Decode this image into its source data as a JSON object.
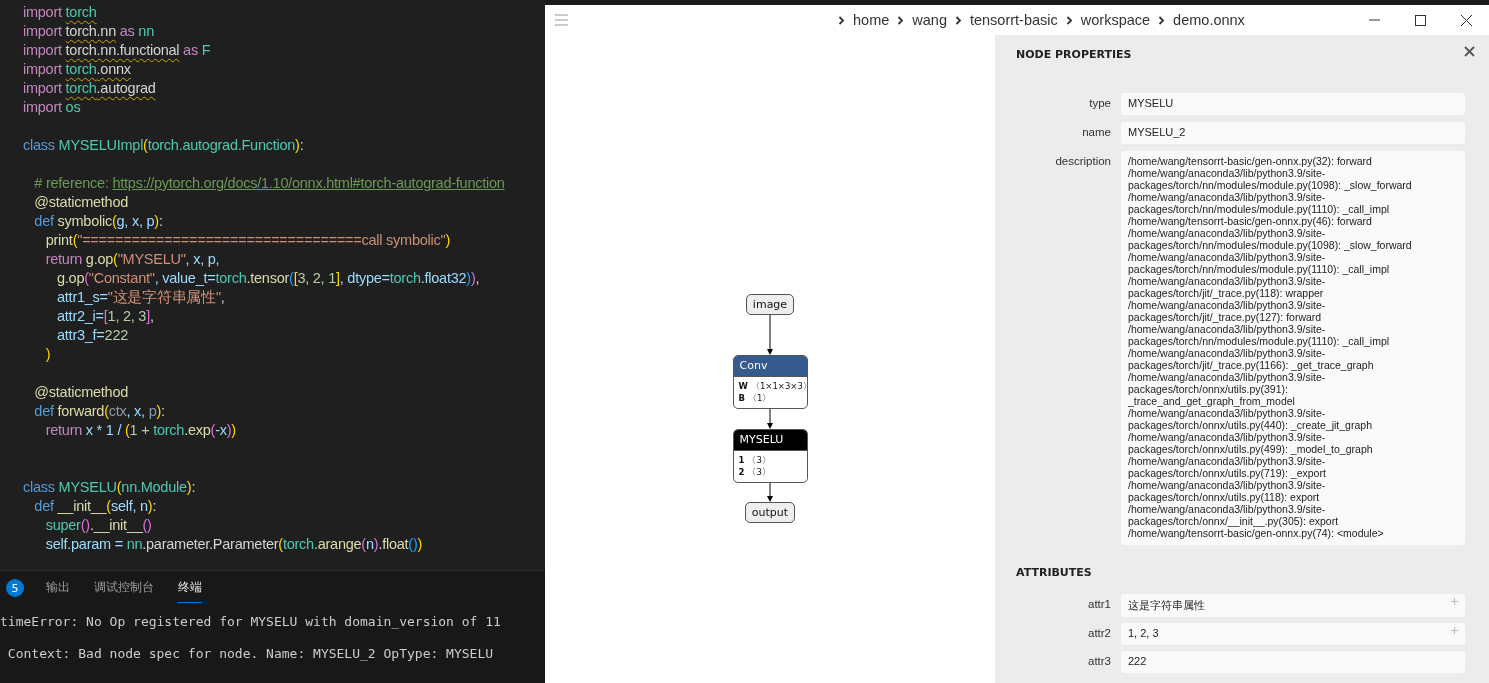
{
  "editor": {
    "lines": [
      {
        "tokens": [
          {
            "text": "import ",
            "kind": "keyword"
          },
          {
            "text": "torch",
            "kind": "module",
            "squiggle": true
          }
        ]
      },
      {
        "tokens": [
          {
            "text": "import ",
            "kind": "keyword"
          },
          {
            "text": "torch.nn",
            "kind": "plain",
            "squiggle": true
          },
          {
            "text": " as ",
            "kind": "keyword"
          },
          {
            "text": "nn",
            "kind": "module"
          }
        ]
      },
      {
        "tokens": [
          {
            "text": "import ",
            "kind": "keyword"
          },
          {
            "text": "torch.nn.functional",
            "kind": "plain",
            "squiggle": true
          },
          {
            "text": " as ",
            "kind": "keyword"
          },
          {
            "text": "F",
            "kind": "module"
          }
        ]
      },
      {
        "tokens": [
          {
            "text": "import ",
            "kind": "keyword"
          },
          {
            "text": "torch",
            "kind": "module",
            "squiggle": true
          },
          {
            "text": ".onnx",
            "kind": "plain",
            "squiggle": true
          }
        ]
      },
      {
        "tokens": [
          {
            "text": "import ",
            "kind": "keyword"
          },
          {
            "text": "torch",
            "kind": "module",
            "squiggle": true
          },
          {
            "text": ".autograd",
            "kind": "plain",
            "squiggle": true
          }
        ]
      },
      {
        "tokens": [
          {
            "text": "import ",
            "kind": "keyword"
          },
          {
            "text": "os",
            "kind": "module"
          }
        ]
      },
      {
        "kind": "after-blank",
        "tokens": [
          {
            "text": "class ",
            "kind": "storage"
          },
          {
            "text": "MYSELUImpl",
            "kind": "module"
          },
          {
            "text": "(",
            "kind": "bracket1"
          },
          {
            "text": "torch.autograd.Function",
            "kind": "module"
          },
          {
            "text": ")",
            "kind": "bracket1"
          },
          {
            "text": ":",
            "kind": "plain"
          }
        ]
      },
      {
        "kind": "after-blank",
        "tokens": [
          {
            "text": "   # reference: ",
            "kind": "comment"
          },
          {
            "text": "https://pytorch.org/docs/1.10/onnx.html#torch-autograd-function",
            "kind": "link"
          }
        ]
      },
      {
        "tokens": [
          {
            "text": "   @staticmethod",
            "kind": "decorator"
          }
        ]
      },
      {
        "tokens": [
          {
            "text": "   def ",
            "kind": "storage"
          },
          {
            "text": "symbolic",
            "kind": "function"
          },
          {
            "text": "(",
            "kind": "bracket1"
          },
          {
            "text": "g, x, p",
            "kind": "variable"
          },
          {
            "text": ")",
            "kind": "bracket1"
          },
          {
            "text": ":",
            "kind": "plain"
          }
        ]
      },
      {
        "tokens": [
          {
            "text": "      print",
            "kind": "function"
          },
          {
            "text": "(",
            "kind": "bracket1"
          },
          {
            "text": "\"==================================call symbolic\"",
            "kind": "string"
          },
          {
            "text": ")",
            "kind": "bracket1"
          }
        ]
      },
      {
        "tokens": [
          {
            "text": "      return ",
            "kind": "keyword"
          },
          {
            "text": "g.op",
            "kind": "function"
          },
          {
            "text": "(",
            "kind": "bracket1"
          },
          {
            "text": "\"MYSELU\"",
            "kind": "string"
          },
          {
            "text": ", x, p,",
            "kind": "variable"
          }
        ]
      },
      {
        "tokens": [
          {
            "text": "         g.op",
            "kind": "function"
          },
          {
            "text": "(",
            "kind": "bracket2"
          },
          {
            "text": "\"Constant\"",
            "kind": "string"
          },
          {
            "text": ", value_t=",
            "kind": "variable"
          },
          {
            "text": "torch",
            "kind": "module"
          },
          {
            "text": ".tensor",
            "kind": "function"
          },
          {
            "text": "(",
            "kind": "bracket3"
          },
          {
            "text": "[",
            "kind": "bracket1"
          },
          {
            "text": "3, 2, 1",
            "kind": "number"
          },
          {
            "text": "]",
            "kind": "bracket1"
          },
          {
            "text": ", dtype=",
            "kind": "variable"
          },
          {
            "text": "torch",
            "kind": "module"
          },
          {
            "text": ".float32",
            "kind": "variable"
          },
          {
            "text": ")",
            "kind": "bracket3"
          },
          {
            "text": ")",
            "kind": "bracket2"
          },
          {
            "text": ",",
            "kind": "plain"
          }
        ]
      },
      {
        "tokens": [
          {
            "text": "         attr1_s=",
            "kind": "variable"
          },
          {
            "text": "\"这是字符串属性\"",
            "kind": "string"
          },
          {
            "text": ",",
            "kind": "plain"
          }
        ]
      },
      {
        "tokens": [
          {
            "text": "         attr2_i=",
            "kind": "variable"
          },
          {
            "text": "[",
            "kind": "bracket2"
          },
          {
            "text": "1, 2, 3",
            "kind": "number"
          },
          {
            "text": "]",
            "kind": "bracket2"
          },
          {
            "text": ",",
            "kind": "plain"
          }
        ]
      },
      {
        "tokens": [
          {
            "text": "         attr3_f=",
            "kind": "variable"
          },
          {
            "text": "222",
            "kind": "number"
          }
        ]
      },
      {
        "tokens": [
          {
            "text": "      )",
            "kind": "bracket1"
          }
        ]
      },
      {
        "kind": "after-blank",
        "tokens": [
          {
            "text": "   @staticmethod",
            "kind": "decorator"
          }
        ]
      },
      {
        "tokens": [
          {
            "text": "   def ",
            "kind": "storage"
          },
          {
            "text": "forward",
            "kind": "function"
          },
          {
            "text": "(",
            "kind": "bracket1"
          },
          {
            "text": "ctx",
            "kind": "unused"
          },
          {
            "text": ", x, ",
            "kind": "variable"
          },
          {
            "text": "p",
            "kind": "unused"
          },
          {
            "text": ")",
            "kind": "bracket1"
          },
          {
            "text": ":",
            "kind": "plain"
          }
        ]
      },
      {
        "tokens": [
          {
            "text": "      return ",
            "kind": "keyword"
          },
          {
            "text": "x * 1 / ",
            "kind": "variable"
          },
          {
            "text": "(",
            "kind": "bracket1"
          },
          {
            "text": "1 + ",
            "kind": "number"
          },
          {
            "text": "torch",
            "kind": "module"
          },
          {
            "text": ".exp",
            "kind": "function"
          },
          {
            "text": "(",
            "kind": "bracket2"
          },
          {
            "text": "-x",
            "kind": "variable"
          },
          {
            "text": ")",
            "kind": "bracket2"
          },
          {
            "text": ")",
            "kind": "bracket1"
          }
        ]
      },
      {
        "kind": "after-two-blanks",
        "tokens": [
          {
            "text": "class ",
            "kind": "storage"
          },
          {
            "text": "MYSELU",
            "kind": "module"
          },
          {
            "text": "(",
            "kind": "bracket1"
          },
          {
            "text": "nn.Module",
            "kind": "module"
          },
          {
            "text": ")",
            "kind": "bracket1"
          },
          {
            "text": ":",
            "kind": "plain"
          }
        ]
      },
      {
        "tokens": [
          {
            "text": "   def ",
            "kind": "storage"
          },
          {
            "text": "__init__",
            "kind": "function"
          },
          {
            "text": "(",
            "kind": "bracket1"
          },
          {
            "text": "self, n",
            "kind": "variable"
          },
          {
            "text": ")",
            "kind": "bracket1"
          },
          {
            "text": ":",
            "kind": "plain"
          }
        ]
      },
      {
        "tokens": [
          {
            "text": "      super",
            "kind": "module"
          },
          {
            "text": "()",
            "kind": "bracket2"
          },
          {
            "text": ".__init__",
            "kind": "function"
          },
          {
            "text": "()",
            "kind": "bracket2"
          }
        ]
      },
      {
        "tokens": [
          {
            "text": "      self.param = ",
            "kind": "variable"
          },
          {
            "text": "nn",
            "kind": "module"
          },
          {
            "text": ".parameter.Parameter",
            "kind": "plain"
          },
          {
            "text": "(",
            "kind": "bracket1"
          },
          {
            "text": "torch",
            "kind": "module"
          },
          {
            "text": ".arange",
            "kind": "function"
          },
          {
            "text": "(",
            "kind": "bracket2"
          },
          {
            "text": "n",
            "kind": "variable"
          },
          {
            "text": ")",
            "kind": "bracket2"
          },
          {
            "text": ".float",
            "kind": "function"
          },
          {
            "text": "()",
            "kind": "bracket3"
          },
          {
            "text": ")",
            "kind": "bracket1"
          }
        ]
      }
    ]
  },
  "panel": {
    "badge": "5",
    "tabs": [
      {
        "label": "输出",
        "selected": false
      },
      {
        "label": "调试控制台",
        "selected": false
      },
      {
        "label": "终端",
        "selected": true
      }
    ],
    "terminal_lines": [
      "timeError: No Op registered for MYSELU with domain_version of 11",
      " Context: Bad node spec for node. Name: MYSELU_2 OpType: MYSELU"
    ]
  },
  "viewer": {
    "breadcrumb": [
      "home",
      "wang",
      "tensorrt-basic",
      "workspace",
      "demo.onnx"
    ],
    "graph": {
      "nodes": [
        {
          "kind": "io",
          "label": "image"
        },
        {
          "kind": "op",
          "label": "Conv",
          "color": "#375a8c",
          "inputs": [
            {
              "name": "W",
              "shape": "〈1×1×3×3〉"
            },
            {
              "name": "B",
              "shape": "〈1〉"
            }
          ]
        },
        {
          "kind": "op",
          "label": "MYSELU",
          "color": "#000000",
          "inputs": [
            {
              "name": "1",
              "shape": "〈3〉"
            },
            {
              "name": "2",
              "shape": "〈3〉"
            }
          ]
        },
        {
          "kind": "io",
          "label": "output"
        }
      ]
    },
    "properties": {
      "title": "NODE PROPERTIES",
      "fields": [
        {
          "label": "type",
          "value": "MYSELU"
        },
        {
          "label": "name",
          "value": "MYSELU_2"
        },
        {
          "label": "description",
          "lines": [
            "/home/wang/tensorrt-basic/gen-onnx.py(32): forward",
            "/home/wang/anaconda3/lib/python3.9/site-",
            "packages/torch/nn/modules/module.py(1098): _slow_forward",
            "/home/wang/anaconda3/lib/python3.9/site-",
            "packages/torch/nn/modules/module.py(1110): _call_impl",
            "/home/wang/tensorrt-basic/gen-onnx.py(46): forward",
            "/home/wang/anaconda3/lib/python3.9/site-",
            "packages/torch/nn/modules/module.py(1098): _slow_forward",
            "/home/wang/anaconda3/lib/python3.9/site-",
            "packages/torch/nn/modules/module.py(1110): _call_impl",
            "/home/wang/anaconda3/lib/python3.9/site-",
            "packages/torch/jit/_trace.py(118): wrapper",
            "/home/wang/anaconda3/lib/python3.9/site-",
            "packages/torch/jit/_trace.py(127): forward",
            "/home/wang/anaconda3/lib/python3.9/site-",
            "packages/torch/nn/modules/module.py(1110): _call_impl",
            "/home/wang/anaconda3/lib/python3.9/site-",
            "packages/torch/jit/_trace.py(1166): _get_trace_graph",
            "/home/wang/anaconda3/lib/python3.9/site-",
            "packages/torch/onnx/utils.py(391):",
            "_trace_and_get_graph_from_model",
            "/home/wang/anaconda3/lib/python3.9/site-",
            "packages/torch/onnx/utils.py(440): _create_jit_graph",
            "/home/wang/anaconda3/lib/python3.9/site-",
            "packages/torch/onnx/utils.py(499): _model_to_graph",
            "/home/wang/anaconda3/lib/python3.9/site-",
            "packages/torch/onnx/utils.py(719): _export",
            "/home/wang/anaconda3/lib/python3.9/site-",
            "packages/torch/onnx/utils.py(118): export",
            "/home/wang/anaconda3/lib/python3.9/site-",
            "packages/torch/onnx/__init__.py(305): export",
            "/home/wang/tensorrt-basic/gen-onnx.py(74): <module>"
          ]
        }
      ],
      "attributes_title": "ATTRIBUTES",
      "attributes": [
        {
          "name": "attr1",
          "value": "这是字符串属性",
          "expandable": true
        },
        {
          "name": "attr2",
          "value": "1, 2, 3",
          "expandable": true
        },
        {
          "name": "attr3",
          "value": "222",
          "expandable": false
        }
      ]
    }
  }
}
